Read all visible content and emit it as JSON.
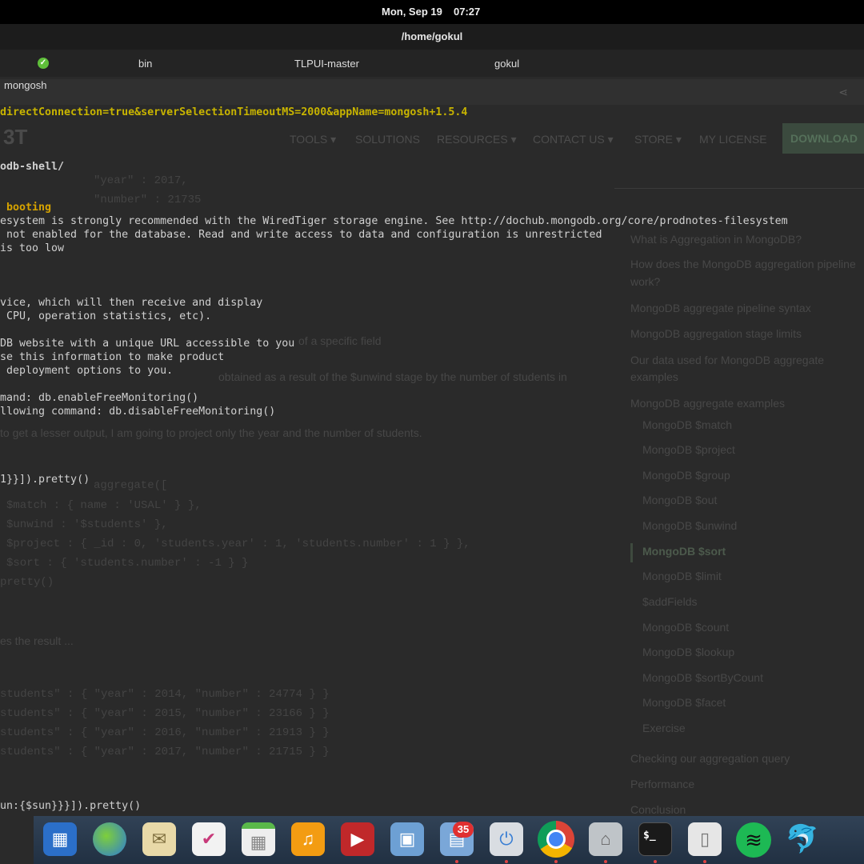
{
  "topbar": {
    "date": "Mon, Sep 19",
    "time": "07:27"
  },
  "window": {
    "title": "/home/gokul"
  },
  "tabs": [
    {
      "label": "bin"
    },
    {
      "label": "TLPUI-master"
    },
    {
      "label": "gokul"
    }
  ],
  "terminal": {
    "tab_title": "mongosh",
    "lines": [
      {
        "text": "directConnection=true&serverSelectionTimeoutMS=2000&appName=mongosh+1.5.4",
        "color": "yellow"
      },
      {
        "text": "odb-shell/",
        "color": "white"
      },
      {
        "text": " booting",
        "color": "orange"
      },
      {
        "text": "esystem is strongly recommended with the WiredTiger storage engine. See http://dochub.mongodb.org/core/prodnotes-filesystem"
      },
      {
        "text": " not enabled for the database. Read and write access to data and configuration is unrestricted"
      },
      {
        "text": "is too low"
      },
      {
        "text": "vice, which will then receive and display"
      },
      {
        "text": " CPU, operation statistics, etc)."
      },
      {
        "text": "DB website with a unique URL accessible to you"
      },
      {
        "text": "se this information to make product"
      },
      {
        "text": " deployment options to you."
      },
      {
        "text": "mand: db.enableFreeMonitoring()"
      },
      {
        "text": "llowing command: db.disableFreeMonitoring()"
      },
      {
        "text": "1}}]).pretty()"
      },
      {
        "text": "un:{$sun}}}]).pretty()"
      }
    ]
  },
  "webpage": {
    "logo": "3T",
    "nav": [
      "TOOLS ▾",
      "SOLUTIONS",
      "RESOURCES ▾",
      "CONTACT US ▾",
      "STORE ▾",
      "MY LICENSE"
    ],
    "download": "DOWNLOAD",
    "toc": [
      "What is Aggregation in MongoDB?",
      "How does the MongoDB aggregation pipeline",
      "work?",
      "MongoDB aggregate pipeline syntax",
      "MongoDB aggregation stage limits",
      "Our data used for MongoDB aggregate",
      "examples",
      "MongoDB aggregate examples",
      "MongoDB $match",
      "MongoDB $project",
      "MongoDB $group",
      "MongoDB $out",
      "MongoDB $unwind",
      "MongoDB $sort",
      "MongoDB $limit",
      "$addFields",
      "MongoDB $count",
      "MongoDB $lookup",
      "MongoDB $sortByCount",
      "MongoDB $facet",
      "Exercise",
      "Checking our aggregation query",
      "Performance",
      "Conclusion"
    ],
    "body": [
      "of a specific field",
      "obtained as a result of the  $unwind  stage by the number of students in",
      " to get a lesser output, I am going to project only the year and the number of students.",
      "es the result ..."
    ],
    "code": [
      "\"year\" : 2017,",
      "\"number\" : 21735",
      "aggregate([",
      "$match : { name : 'USAL' } },",
      "$unwind : '$students' },",
      "$project : { _id : 0, 'students.year' : 1, 'students.number' : 1 } },",
      "$sort : { 'students.number' : -1 } }",
      "pretty()",
      "students\" : { \"year\" : 2014, \"number\" : 24774 } }",
      "students\" : { \"year\" : 2015, \"number\" : 23166 } }",
      "students\" : { \"year\" : 2016, \"number\" : 21913 } }",
      "students\" : { \"year\" : 2017, \"number\" : 21715 } }"
    ]
  },
  "dock": {
    "badge_count": "35",
    "icons": [
      "workspaces-icon",
      "web-browser-icon",
      "mail-icon",
      "planner-icon",
      "calendar-icon",
      "music-icon",
      "video-icon",
      "photos-icon",
      "appcenter-icon",
      "settings-icon",
      "chrome-icon",
      "files-icon",
      "terminal-icon",
      "archive-icon",
      "spotify-icon",
      "mysql-workbench-icon"
    ]
  }
}
